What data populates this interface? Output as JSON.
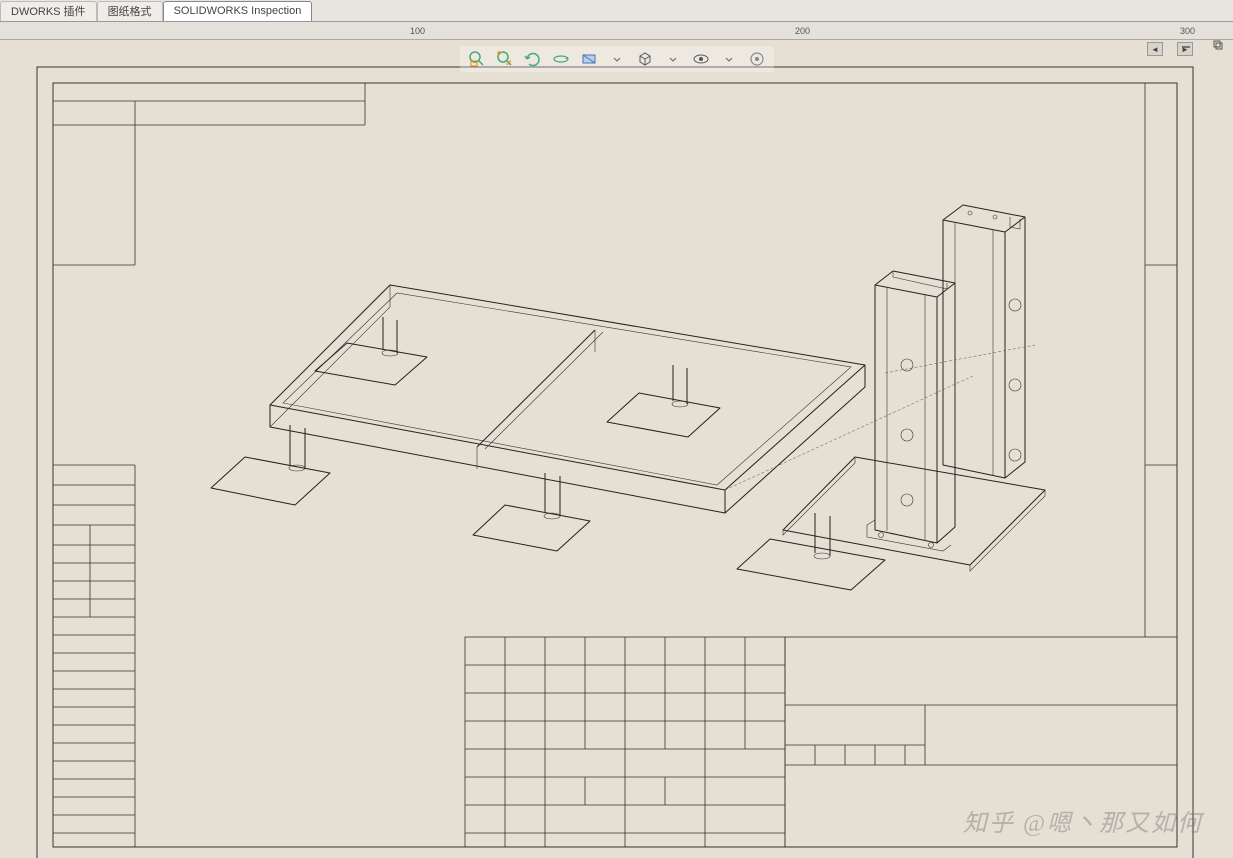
{
  "tabs": {
    "plugin": "DWORKS 插件",
    "format": "图纸格式",
    "inspection": "SOLIDWORKS Inspection"
  },
  "ruler": {
    "marks": [
      "100",
      "200",
      "300"
    ]
  },
  "view_tools": {
    "zoom_area": "zoom-area",
    "zoom_fit": "zoom-fit",
    "previous_view": "previous-view",
    "rotate": "rotate",
    "redraw": "redraw",
    "section": "section",
    "display_style": "display-style",
    "hide_show": "hide-show",
    "dropdown": "dropdown"
  },
  "watermark": "知乎 @嗯丶那又如何"
}
